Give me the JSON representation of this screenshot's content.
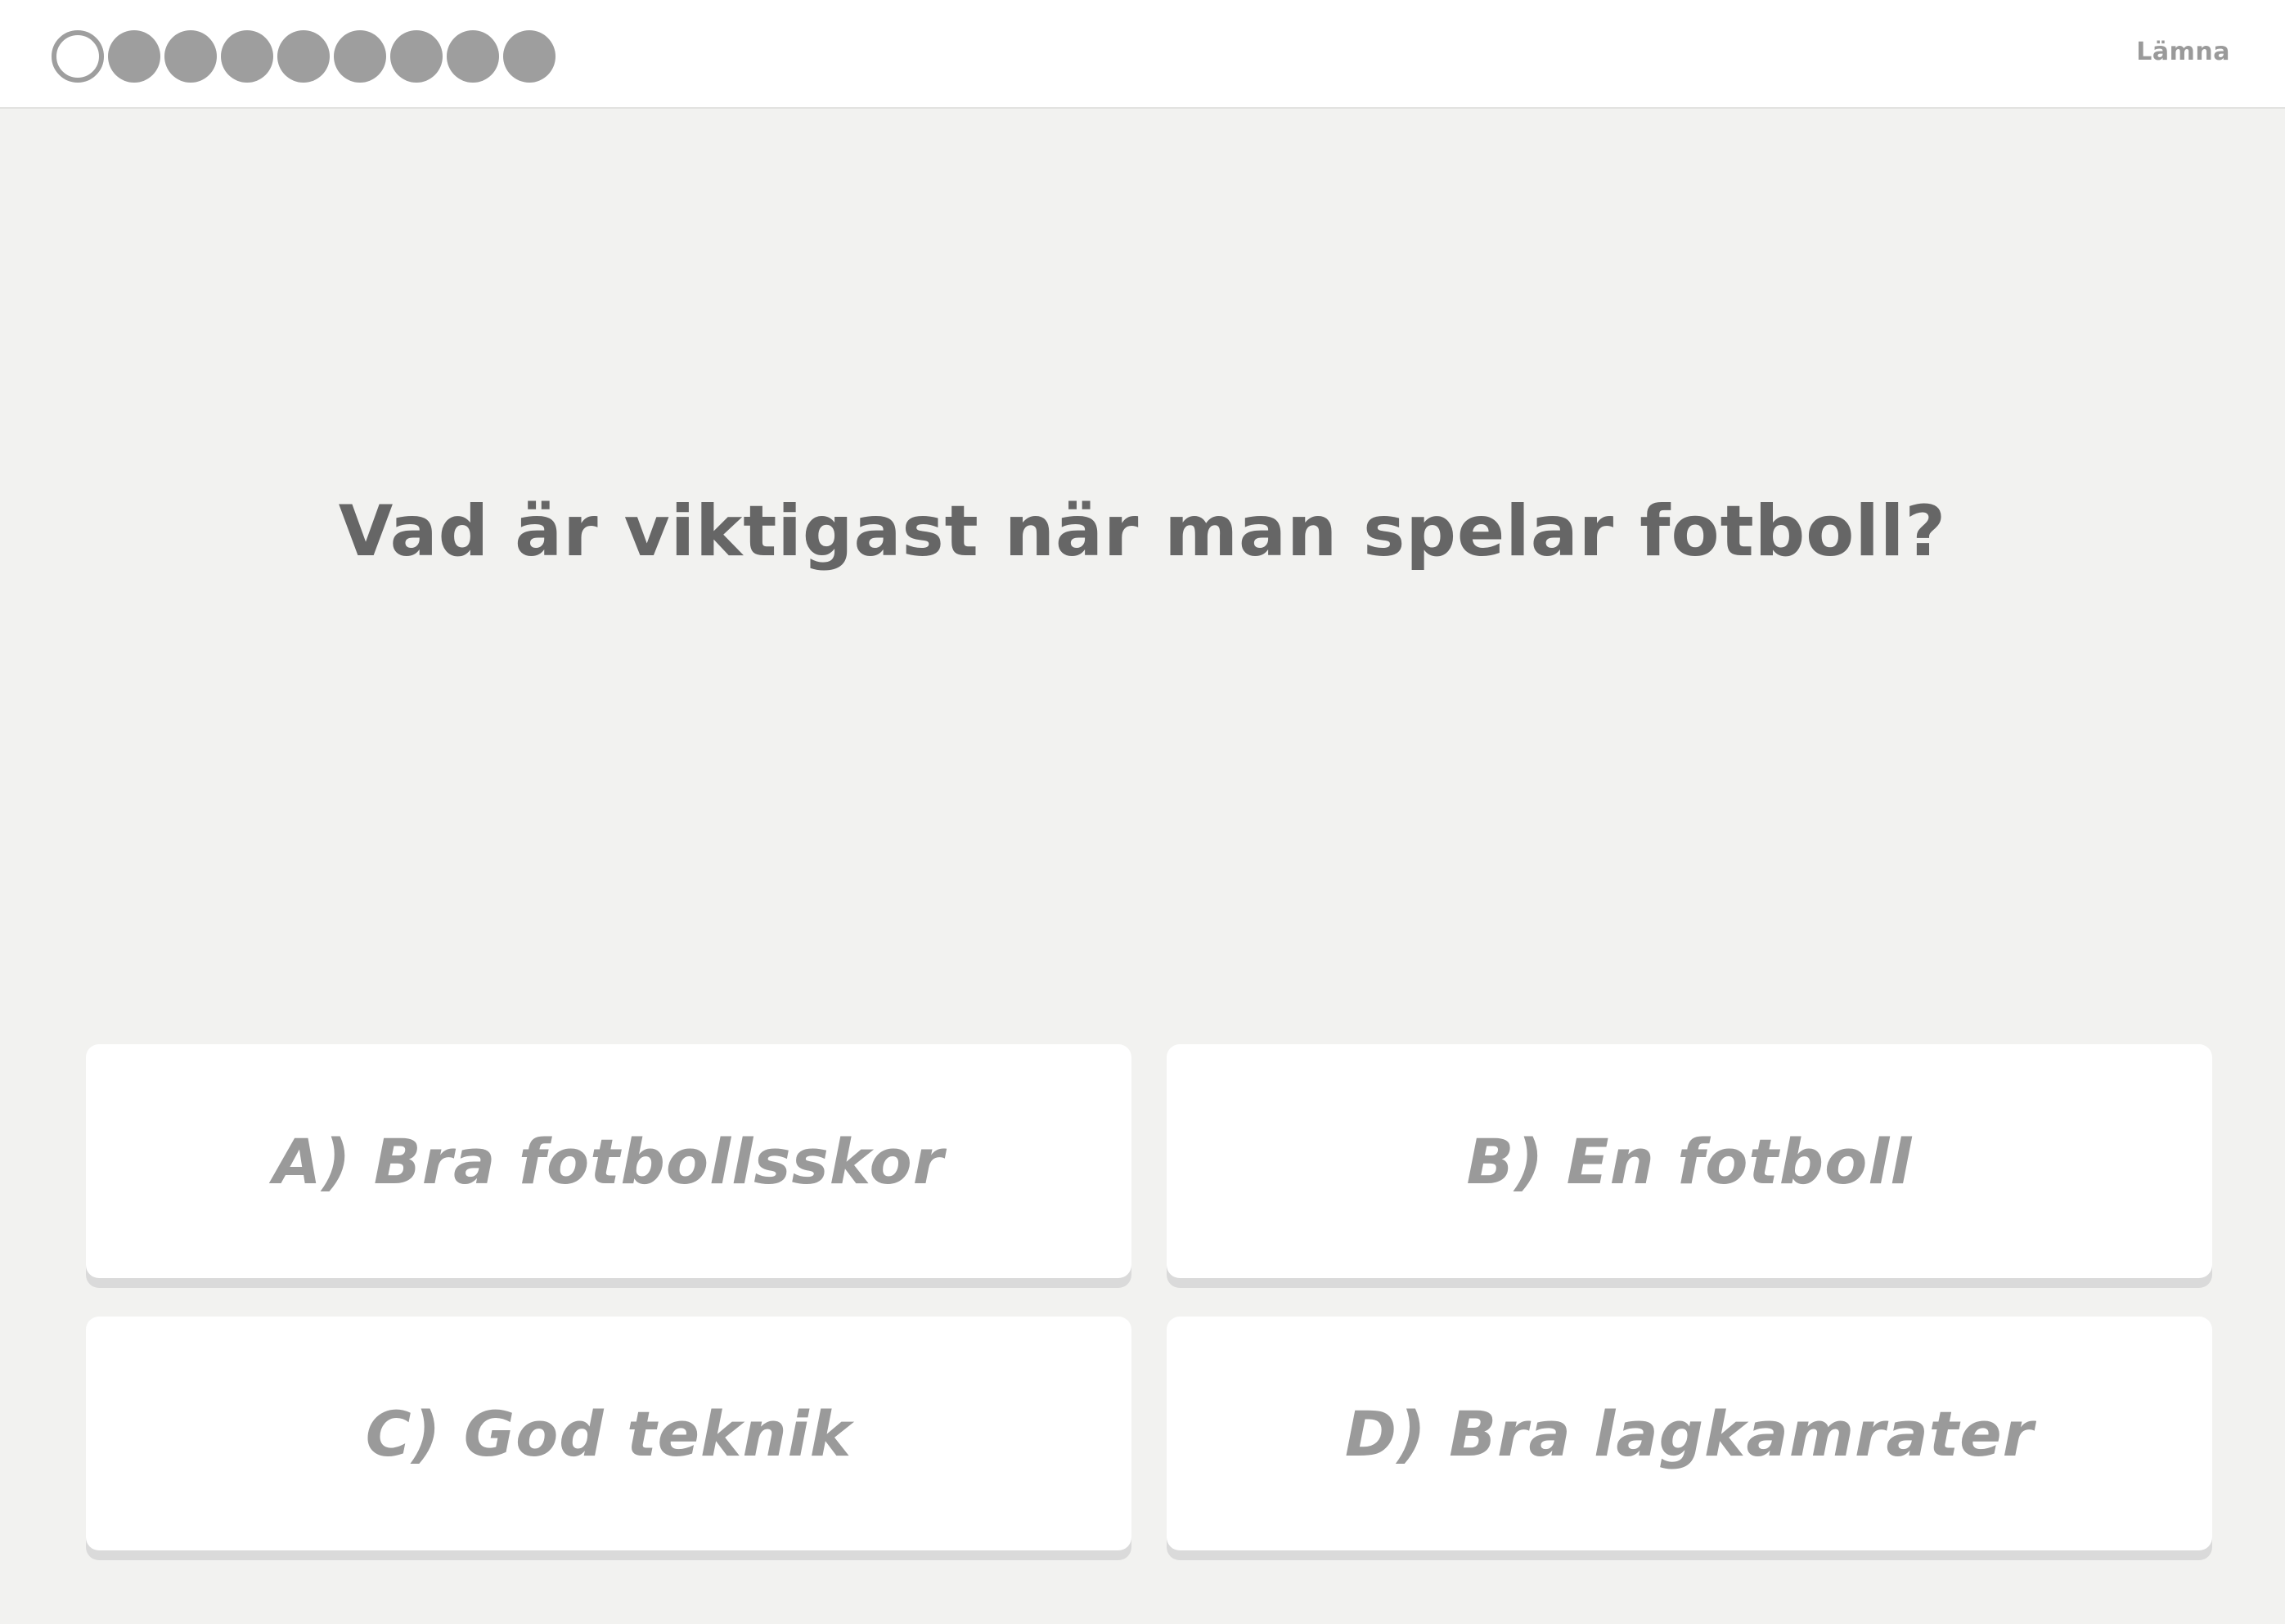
{
  "header": {
    "progress": {
      "total": 9,
      "current_index": 0
    },
    "leave_label": "Lämna"
  },
  "question": {
    "text": "Vad är viktigast när man spelar fotboll?"
  },
  "answers": [
    {
      "label": "A) Bra fotbollsskor"
    },
    {
      "label": "B) En fotboll"
    },
    {
      "label": "C) God teknik"
    },
    {
      "label": "D) Bra lagkamrater"
    }
  ],
  "colors": {
    "background": "#f2f2f0",
    "topbar": "#ffffff",
    "progress_dot": "#9e9e9e",
    "question_text": "#666666",
    "answer_text": "#9a9a9a",
    "answer_card": "#ffffff"
  }
}
